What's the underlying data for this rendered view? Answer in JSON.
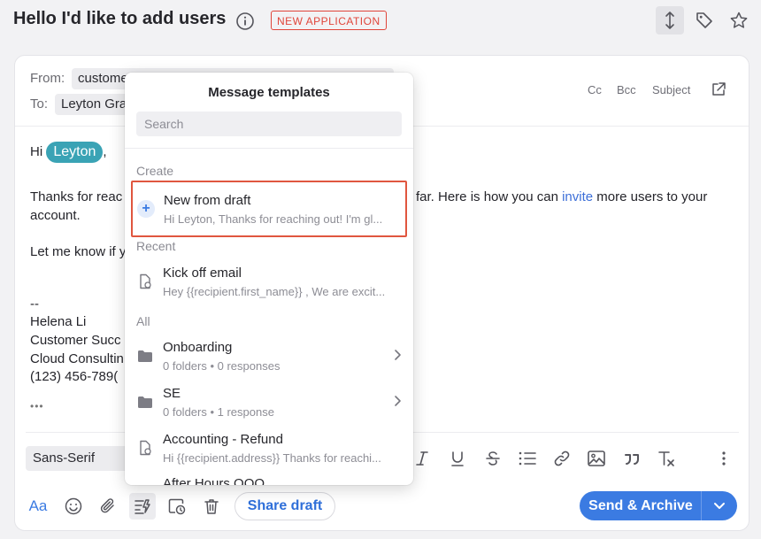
{
  "header": {
    "title": "Hello I'd like to add users",
    "badge": "NEW APPLICATION"
  },
  "compose": {
    "from_label": "From:",
    "from_value": "custome",
    "to_label": "To:",
    "to_value": "Leyton Gra",
    "header_links": {
      "cc": "Cc",
      "bcc": "Bcc",
      "subject": "Subject"
    },
    "body": {
      "greeting": "Hi",
      "mention": "Leyton",
      "greeting_comma": ",",
      "line1_left": "Thanks for reac",
      "line1_right": "far. Here is how you can",
      "invite_link": "invite",
      "line1_end": "more users to your",
      "line2": "account.",
      "line3": "Let me know if y",
      "sig_dash": "--",
      "sig_name": "Helena Li",
      "sig_title": "Customer Succ",
      "sig_company": "Cloud Consultin",
      "sig_phone": "(123) 456-789(",
      "ellipsis": "•••"
    },
    "font_select": "Sans-Serif"
  },
  "bottom": {
    "share_draft": "Share draft",
    "send_archive": "Send & Archive"
  },
  "templates_popup": {
    "title": "Message templates",
    "search_placeholder": "Search",
    "sections": {
      "create": "Create",
      "recent": "Recent",
      "all": "All"
    },
    "create_item": {
      "name": "New from draft",
      "preview": "Hi Leyton, Thanks for reaching out! I'm gl..."
    },
    "recent_item": {
      "name": "Kick off email",
      "preview": "Hey {{recipient.first_name}} , We are excit..."
    },
    "folders": [
      {
        "name": "Onboarding",
        "meta": "0 folders • 0 responses"
      },
      {
        "name": "SE",
        "meta": "0 folders • 1 response"
      }
    ],
    "all_item": {
      "name": "Accounting - Refund",
      "preview": "Hi {{recipient.address}} Thanks for reachi..."
    },
    "cutoff_item": "After Hours OOO"
  },
  "colors": {
    "accent": "#3b7be2",
    "badge": "#e0453a",
    "mention": "#3aa3b5",
    "highlight": "#e0563f"
  }
}
